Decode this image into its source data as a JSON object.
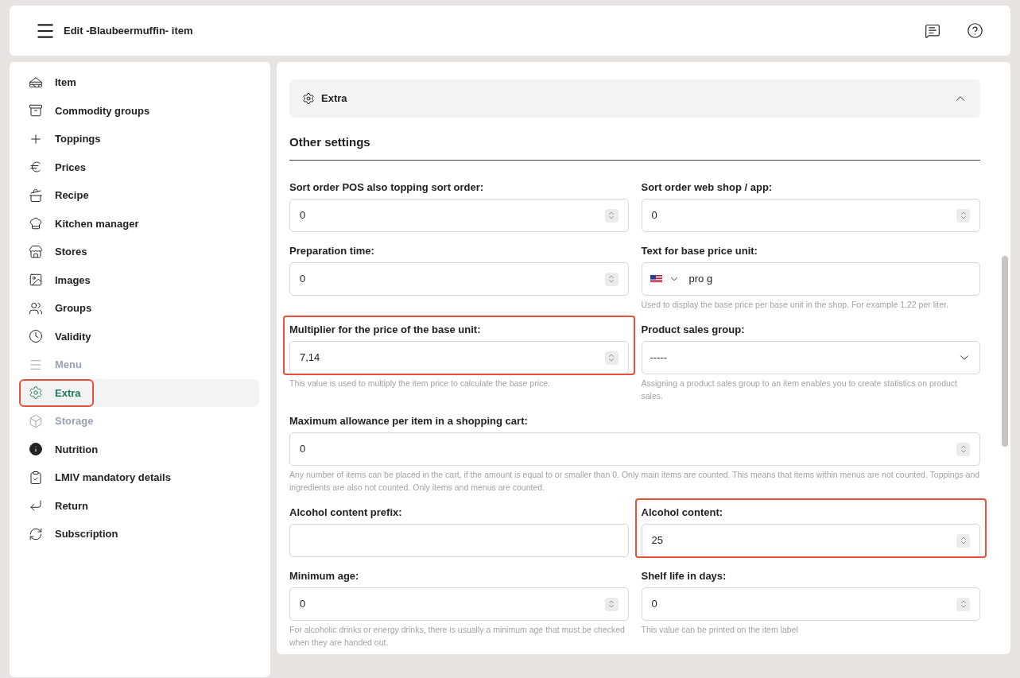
{
  "header": {
    "title": "Edit -Blaubeermuffin- item"
  },
  "sidebar": {
    "items": [
      {
        "label": "Item",
        "selected": false,
        "disabled": false,
        "highlighted": false
      },
      {
        "label": "Commodity groups",
        "selected": false,
        "disabled": false,
        "highlighted": false
      },
      {
        "label": "Toppings",
        "selected": false,
        "disabled": false,
        "highlighted": false
      },
      {
        "label": "Prices",
        "selected": false,
        "disabled": false,
        "highlighted": false
      },
      {
        "label": "Recipe",
        "selected": false,
        "disabled": false,
        "highlighted": false
      },
      {
        "label": "Kitchen manager",
        "selected": false,
        "disabled": false,
        "highlighted": false
      },
      {
        "label": "Stores",
        "selected": false,
        "disabled": false,
        "highlighted": false
      },
      {
        "label": "Images",
        "selected": false,
        "disabled": false,
        "highlighted": false
      },
      {
        "label": "Groups",
        "selected": false,
        "disabled": false,
        "highlighted": false
      },
      {
        "label": "Validity",
        "selected": false,
        "disabled": false,
        "highlighted": false
      },
      {
        "label": "Menu",
        "selected": false,
        "disabled": true,
        "highlighted": false
      },
      {
        "label": "Extra",
        "selected": true,
        "disabled": false,
        "highlighted": true
      },
      {
        "label": "Storage",
        "selected": false,
        "disabled": true,
        "highlighted": false
      },
      {
        "label": "Nutrition",
        "selected": false,
        "disabled": false,
        "highlighted": false
      },
      {
        "label": "LMIV mandatory details",
        "selected": false,
        "disabled": false,
        "highlighted": false
      },
      {
        "label": "Return",
        "selected": false,
        "disabled": false,
        "highlighted": false
      },
      {
        "label": "Subscription",
        "selected": false,
        "disabled": false,
        "highlighted": false
      }
    ]
  },
  "section": {
    "title": "Extra",
    "expanded": true
  },
  "subsection": {
    "title": "Other settings"
  },
  "rows": [
    [
      {
        "kind": "number",
        "label": "Sort order POS also topping sort order:",
        "value": "0",
        "highlighted": false
      },
      {
        "kind": "number",
        "label": "Sort order web shop / app:",
        "value": "0",
        "highlighted": false
      }
    ],
    [
      {
        "kind": "number",
        "label": "Preparation time:",
        "value": "0",
        "highlighted": false
      },
      {
        "kind": "language",
        "label": "Text for base price unit:",
        "value": "pro g",
        "help": "Used to display the base price per base unit in the shop. For example 1.22 per liter.",
        "highlighted": false
      }
    ],
    [
      {
        "kind": "number",
        "label": "Multiplier for the price of the base unit:",
        "value": "7,14",
        "help": "This value is used to multiply the item price to calculate the base price.",
        "highlighted": true
      },
      {
        "kind": "select",
        "label": "Product sales group:",
        "value": "-----",
        "help": "Assigning a product sales group to an item enables you to create statistics on product sales.",
        "highlighted": false
      }
    ],
    [
      {
        "kind": "number",
        "label": "Maximum allowance per item in a shopping cart:",
        "value": "0",
        "help": "Any number of items can be placed in the cart, if the amount is equal to or smaller than 0. Only main items are counted. This means that items within menus are not counted. Toppings and ingredients are also not counted. Only items and menus are counted.",
        "highlighted": false
      }
    ],
    [
      {
        "kind": "text",
        "label": "Alcohol content prefix:",
        "highlighted": false
      },
      {
        "kind": "number",
        "label": "Alcohol content:",
        "value": "25",
        "highlighted": true
      }
    ],
    [
      {
        "kind": "number",
        "label": "Minimum age:",
        "value": "0",
        "help": "For alcoholic drinks or energy drinks, there is usually a minimum age that must be checked when they are handed out.",
        "highlighted": false
      },
      {
        "kind": "number",
        "label": "Shelf life in days:",
        "value": "0",
        "help": "This value can be printed on the item label",
        "highlighted": false
      }
    ]
  ]
}
